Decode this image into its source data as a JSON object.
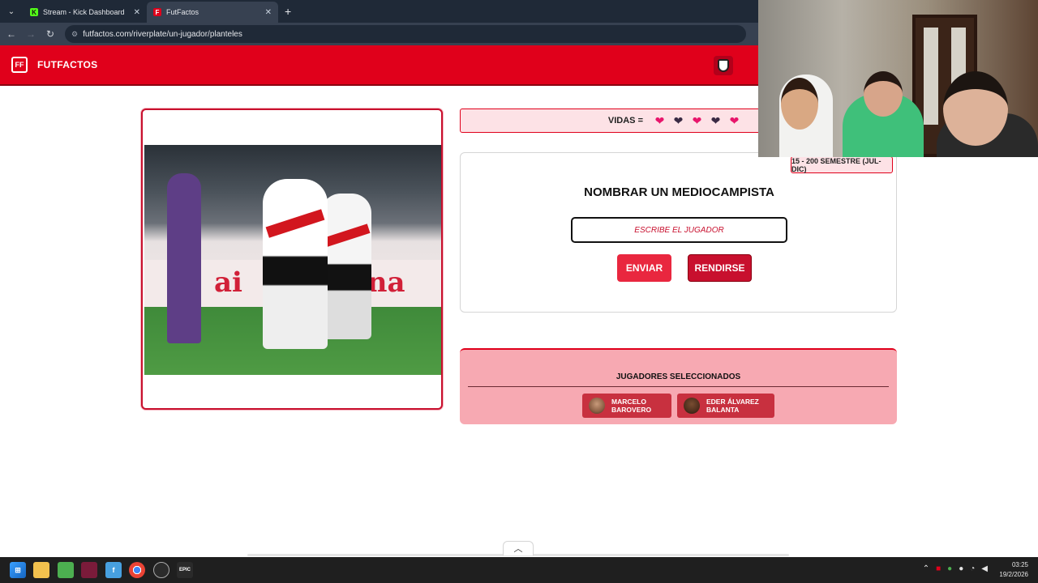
{
  "browser": {
    "tabs": [
      {
        "label": "Stream - Kick Dashboard",
        "icon": "kick-icon"
      },
      {
        "label": "FutFactos",
        "icon": "futfactos-icon"
      }
    ],
    "url": "futfactos.com/riverplate/un-jugador/planteles"
  },
  "header": {
    "brand": "FUTFACTOS",
    "logo_text": "FF"
  },
  "image_panel": {
    "ad_text_left": "ai",
    "ad_text_right": "nna"
  },
  "lives": {
    "label": "VIDAS =",
    "hearts": [
      {
        "state": "full",
        "color": "#e8156b"
      },
      {
        "state": "lost",
        "color": "#3a2a44"
      },
      {
        "state": "full",
        "color": "#e8156b"
      },
      {
        "state": "lost",
        "color": "#3a2a44"
      },
      {
        "state": "full",
        "color": "#e8156b"
      }
    ]
  },
  "question": {
    "season": "15 - 200 SEMESTRE (JUL-DIC)",
    "title": "NOMBRAR UN MEDIOCAMPISTA",
    "input_placeholder": "ESCRIBE EL JUGADOR",
    "send_label": "ENVIAR",
    "giveup_label": "RENDIRSE"
  },
  "selected": {
    "title": "JUGADORES SELECCIONADOS",
    "players": [
      "MARCELO BAROVERO",
      "EDER ÁLVAREZ BALANTA"
    ]
  },
  "taskbar": {
    "time": "03:25",
    "date": "19/2/2026"
  },
  "colors": {
    "brand_red": "#e0001b",
    "selected_bg": "#f7a9b2",
    "heart_full": "#e8156b",
    "heart_lost": "#3a2a44"
  }
}
